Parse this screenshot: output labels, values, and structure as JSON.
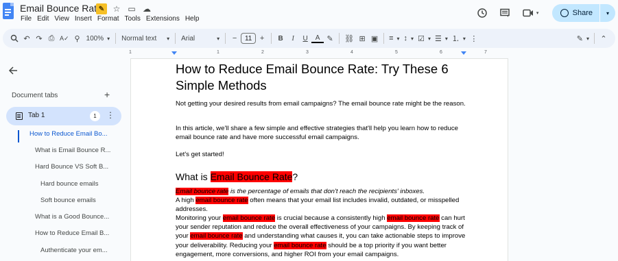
{
  "app": {
    "doc_title": "Email Bounce Rate",
    "menu": [
      "File",
      "Edit",
      "View",
      "Insert",
      "Format",
      "Tools",
      "Extensions",
      "Help"
    ],
    "share_label": "Share"
  },
  "toolbar": {
    "zoom": "100%",
    "style": "Normal text",
    "font": "Arial",
    "font_size": "11",
    "minus": "−",
    "plus": "+"
  },
  "ruler": {
    "numbers": [
      "1",
      "1",
      "2",
      "3",
      "4",
      "5",
      "6",
      "7"
    ]
  },
  "sidebar": {
    "tabs_heading": "Document tabs",
    "tab_name": "Tab 1",
    "tab_badge": "1",
    "outline": [
      "How to Reduce Email Bo...",
      "What is Email Bounce R...",
      "Hard Bounce VS Soft B...",
      "Hard bounce emails",
      "Soft bounce emails",
      "What is a Good Bounce...",
      "How to Reduce Email B...",
      "Authenticate your em..."
    ]
  },
  "document": {
    "title": "How to Reduce Email Bounce Rate: Try These 6 Simple Methods",
    "p1": "Not getting your desired results from email campaigns? The email bounce rate might be the reason.",
    "p2": "In this article, we'll share a few simple and effective strategies that'll help you learn how to reduce email bounce rate and have more successful email campaigns.",
    "p3": "Let's get started!",
    "h2_prefix": "What is ",
    "h2_highlight": "Email Bounce Rate",
    "h2_suffix": "?",
    "highlight_term": "email bounce rate",
    "def_highlight": "Email bounce rate",
    "def_rest": " is the percentage of emails that don't reach the recipients' inboxes.",
    "line_a_1": "A high ",
    "line_a_2": " often means that your email list includes invalid, outdated, or misspelled addresses.",
    "line_b_1": "Monitoring your ",
    "line_b_2": " is crucial because a consistently high ",
    "line_b_3": " can hurt your sender reputation and reduce the overall effectiveness of your campaigns. By keeping track of your ",
    "line_b_4": " and understanding what causes it, you can take actionable steps to improve your deliverability. Reducing your ",
    "line_b_5": " should be a top priority if you want better engagement, more conversions, and higher ROI from your email campaigns."
  }
}
